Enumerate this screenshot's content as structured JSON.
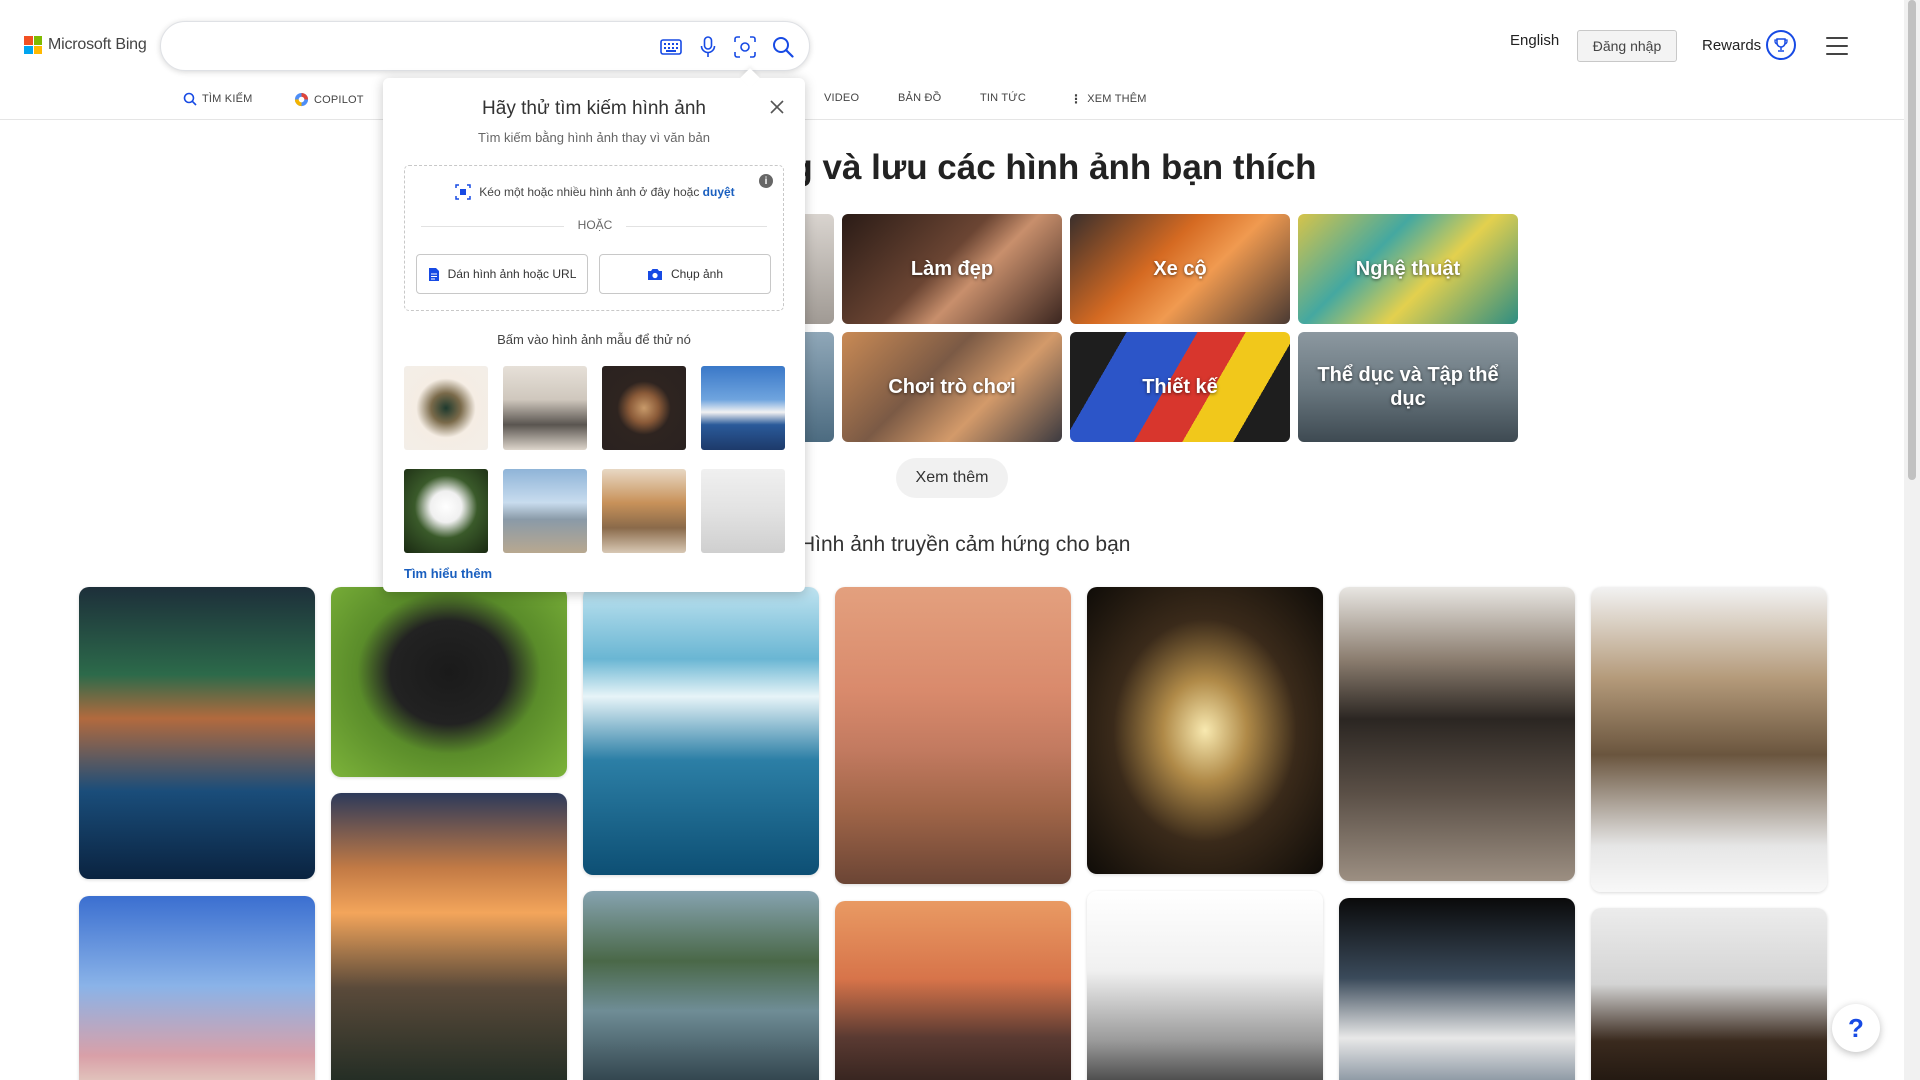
{
  "header": {
    "logo_text": "Microsoft Bing",
    "search": {
      "value": "",
      "placeholder": ""
    },
    "language": "English",
    "signin_label": "Đăng nhập",
    "rewards_label": "Rewards"
  },
  "nav": {
    "items": [
      {
        "label": "TÌM KIẾM",
        "icon": "search-icon"
      },
      {
        "label": "COPILOT",
        "icon": "copilot-icon"
      },
      {
        "label": "VIDEO"
      },
      {
        "label": "BẢN ĐỒ"
      },
      {
        "label": "TIN TỨC"
      },
      {
        "label": "XEM THÊM",
        "icon": "more-vertical-icon"
      }
    ]
  },
  "main": {
    "heading": "ng và lưu các hình ảnh bạn thích",
    "categories": [
      {
        "label": "Làm đẹp",
        "color": "#5a3a2e"
      },
      {
        "label": "Xe cộ",
        "color": "#b4602a"
      },
      {
        "label": "Nghệ thuật",
        "color": "#5aa39a"
      },
      {
        "label": "Chơi trò chơi",
        "color": "#9a6a48"
      },
      {
        "label": "Thiết kế",
        "color": "#2f4fa8"
      },
      {
        "label": "Thể dục và Tập thể dục",
        "color": "#5f6e78"
      }
    ],
    "more_label": "Xem thêm",
    "inspiration_heading": "Hình ảnh truyền cảm hứng cho bạn"
  },
  "popup": {
    "title": "Hãy thử tìm kiếm hình ảnh",
    "subtitle": "Tìm kiếm bằng hình ảnh thay vì văn bản",
    "drop_text": "Kéo một hoặc nhiều hình ảnh ở đây hoặc",
    "browse_label": "duyệt",
    "or_label": "HOẶC",
    "paste_label": "Dán hình ảnh hoặc URL",
    "camera_label": "Chụp ảnh",
    "samples_caption": "Bấm vào hình ảnh mẫu để thử nó",
    "learn_more": "Tìm hiểu thêm",
    "samples": [
      "sunglasses",
      "dining-room",
      "coffee-cups",
      "sydney-opera-house",
      "white-rose",
      "louvre-pyramid",
      "dogs",
      "white-chair"
    ]
  },
  "colors": {
    "accent": "#174ae4",
    "link": "#1a5fbf"
  }
}
